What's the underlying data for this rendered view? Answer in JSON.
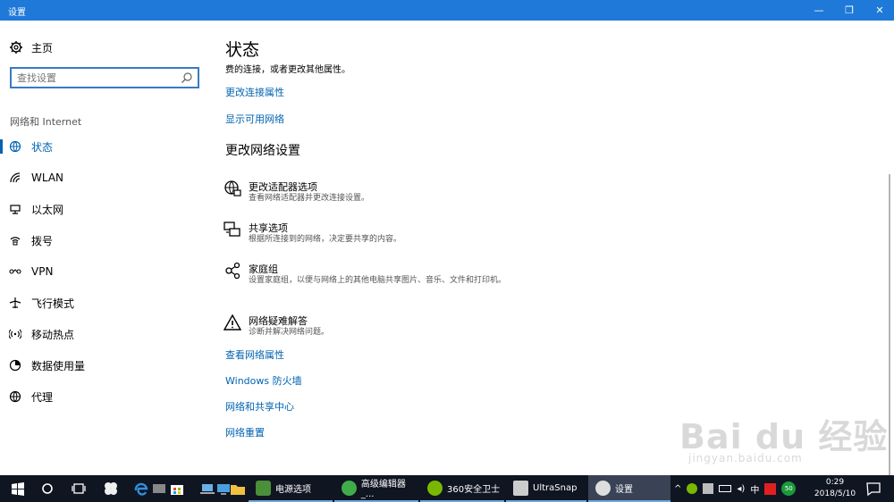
{
  "window": {
    "title": "设置",
    "minimize": "—",
    "maximize": "❐",
    "close": "✕"
  },
  "sidebar": {
    "home_label": "主页",
    "search_placeholder": "查找设置",
    "section_label": "网络和 Internet",
    "items": [
      {
        "label": "状态",
        "icon": "globe-icon",
        "active": true
      },
      {
        "label": "WLAN",
        "icon": "wifi-icon"
      },
      {
        "label": "以太网",
        "icon": "ethernet-icon"
      },
      {
        "label": "拨号",
        "icon": "dialup-icon"
      },
      {
        "label": "VPN",
        "icon": "vpn-icon"
      },
      {
        "label": "飞行模式",
        "icon": "airplane-icon"
      },
      {
        "label": "移动热点",
        "icon": "hotspot-icon"
      },
      {
        "label": "数据使用量",
        "icon": "data-usage-icon"
      },
      {
        "label": "代理",
        "icon": "globe-icon"
      }
    ]
  },
  "main": {
    "title": "状态",
    "subtext": "费的连接，或者更改其他属性。",
    "links_top": [
      "更改连接属性",
      "显示可用网络"
    ],
    "section_title": "更改网络设置",
    "options": [
      {
        "name": "更改适配器选项",
        "desc": "查看网络适配器并更改连接设置。",
        "icon": "adapter-icon"
      },
      {
        "name": "共享选项",
        "desc": "根据所连接到的网络，决定要共享的内容。",
        "icon": "sharing-icon"
      },
      {
        "name": "家庭组",
        "desc": "设置家庭组，以便与网络上的其他电脑共享图片、音乐、文件和打印机。",
        "icon": "homegroup-icon"
      },
      {
        "name": "网络疑难解答",
        "desc": "诊断并解决网络问题。",
        "icon": "warning-icon"
      }
    ],
    "links_bottom": [
      "查看网络属性",
      "Windows 防火墙",
      "网络和共享中心",
      "网络重置"
    ]
  },
  "watermark": {
    "text": "Bai  du 经验",
    "url": "jingyan.baidu.com"
  },
  "taskbar": {
    "apps": [
      {
        "label": "电源选项",
        "color": "#4a8f3a"
      },
      {
        "label": "高级编辑器_...",
        "color": "#3fae49"
      },
      {
        "label": "360安全卫士",
        "color": "#7ab800"
      },
      {
        "label": "UltraSnap",
        "color": "#cccccc"
      },
      {
        "label": "设置",
        "color": "#dddddd"
      }
    ],
    "ime": "中",
    "badge": "50",
    "time": "0:29",
    "date": "2018/5/10"
  },
  "colors": {
    "accent": "#0063b1",
    "titlebar": "#1f79d8",
    "taskbar": "#101522"
  }
}
